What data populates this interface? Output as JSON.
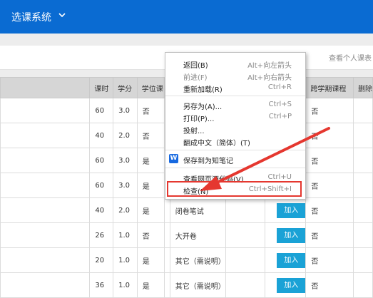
{
  "app": {
    "title": "选课系统"
  },
  "toolbar": {
    "personal_link": "查看个人课表"
  },
  "table": {
    "headers": [
      "课时",
      "学分",
      "学位课",
      "",
      "",
      "",
      "跨学期课程",
      "删除"
    ],
    "rows": [
      {
        "hours": "60",
        "credit": "3.0",
        "degree": "否",
        "exam": "",
        "action": "",
        "cross": "否"
      },
      {
        "hours": "40",
        "credit": "2.0",
        "degree": "否",
        "exam": "",
        "action": "",
        "cross": "否"
      },
      {
        "hours": "60",
        "credit": "3.0",
        "degree": "是",
        "exam": "",
        "action": "",
        "cross": "否"
      },
      {
        "hours": "60",
        "credit": "3.0",
        "degree": "是",
        "exam": "",
        "action": "",
        "cross": "否"
      },
      {
        "hours": "40",
        "credit": "2.0",
        "degree": "是",
        "exam": "闭卷笔试",
        "action": "加入",
        "cross": "否"
      },
      {
        "hours": "26",
        "credit": "1.0",
        "degree": "否",
        "exam": "大开卷",
        "action": "加入",
        "cross": "否"
      },
      {
        "hours": "20",
        "credit": "1.0",
        "degree": "是",
        "exam": "其它（需说明）",
        "action": "加入",
        "cross": "否"
      },
      {
        "hours": "36",
        "credit": "1.0",
        "degree": "是",
        "exam": "其它（需说明）",
        "action": "加入",
        "cross": "否"
      }
    ]
  },
  "context_menu": {
    "back": {
      "label": "返回(B)",
      "shortcut": "Alt+向左箭头"
    },
    "forward": {
      "label": "前进(F)",
      "shortcut": "Alt+向右箭头"
    },
    "reload": {
      "label": "重新加载(R)",
      "shortcut": "Ctrl+R"
    },
    "save_as": {
      "label": "另存为(A)...",
      "shortcut": "Ctrl+S"
    },
    "print": {
      "label": "打印(P)...",
      "shortcut": "Ctrl+P"
    },
    "cast": {
      "label": "投射..."
    },
    "translate": {
      "label": "翻成中文（简体）(T)"
    },
    "save_note": {
      "label": "保存到为知笔记",
      "icon": "wiz-note-icon"
    },
    "view_source": {
      "label": "查看网页源代码(V)",
      "shortcut": "Ctrl+U"
    },
    "inspect": {
      "label": "检查(N)",
      "shortcut": "Ctrl+Shift+I"
    }
  },
  "colors": {
    "brand": "#0a6bd2",
    "add_button": "#1aa2d6",
    "annotation": "#e5372f"
  }
}
